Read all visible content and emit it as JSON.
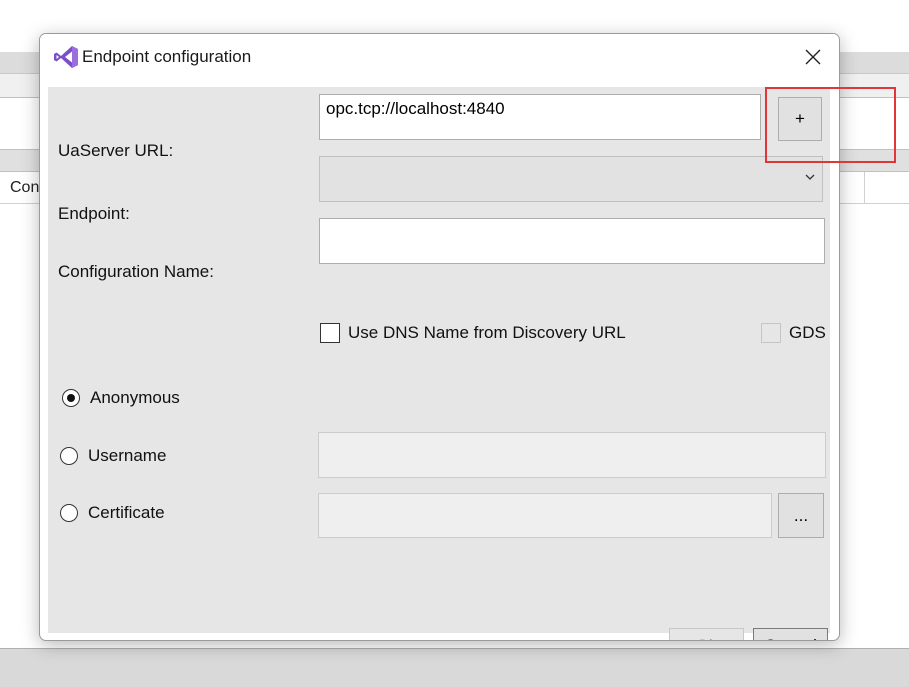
{
  "background": {
    "column_header_text": "Con"
  },
  "dialog": {
    "title": "Endpoint configuration",
    "app_icon": "visual-studio-icon",
    "close_icon": "close-icon",
    "fields": {
      "server_url_label": "UaServer URL:",
      "server_url_value": "opc.tcp://localhost:4840",
      "add_button_label": "+",
      "endpoint_label": "Endpoint:",
      "endpoint_value": "",
      "config_name_label": "Configuration Name:",
      "config_name_value": "",
      "use_dns_label": "Use DNS Name from Discovery URL",
      "use_dns_checked": false,
      "gds_label": "GDS",
      "gds_checked": false
    },
    "auth": {
      "anonymous_label": "Anonymous",
      "username_label": "Username",
      "certificate_label": "Certificate",
      "selected": "anonymous",
      "browse_button_label": "..."
    },
    "buttons": {
      "ok_label": "Ok",
      "cancel_label": "Cancel"
    }
  },
  "colors": {
    "highlight": "#e0363a",
    "vs_purple": "#7b4fc8",
    "dialog_bg": "#e6e6e6"
  }
}
